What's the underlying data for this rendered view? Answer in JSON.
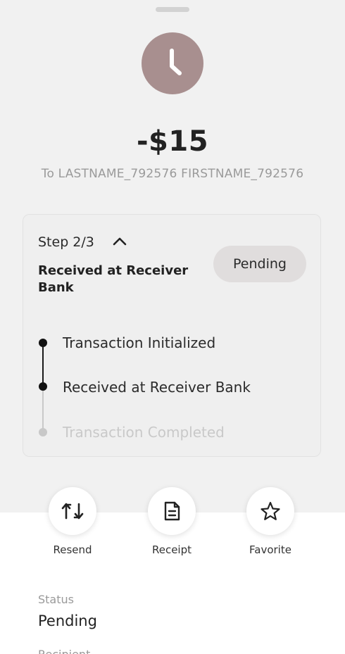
{
  "header": {
    "status_icon": "clock-icon",
    "amount": "-$15",
    "recipient": "To LASTNAME_792576 FIRSTNAME_792576"
  },
  "progress_card": {
    "step_label": "Step 2/3",
    "title": "Received at Receiver Bank",
    "status_badge": "Pending",
    "steps": [
      {
        "label": "Transaction Initialized",
        "done": true
      },
      {
        "label": "Received at Receiver Bank",
        "done": true
      },
      {
        "label": "Transaction Completed",
        "done": false
      }
    ]
  },
  "actions": [
    {
      "label": "Resend",
      "icon": "repeat-icon"
    },
    {
      "label": "Receipt",
      "icon": "receipt-icon"
    },
    {
      "label": "Favorite",
      "icon": "star-icon"
    }
  ],
  "details": {
    "status_label": "Status",
    "status_value": "Pending",
    "next_label": "Recipient"
  },
  "colors": {
    "sheet_bg": "#f1f1f1",
    "icon_bg": "#a88f8f",
    "pill_bg": "#e0dddd",
    "done": "#111111",
    "todo": "#c8c8c8"
  }
}
